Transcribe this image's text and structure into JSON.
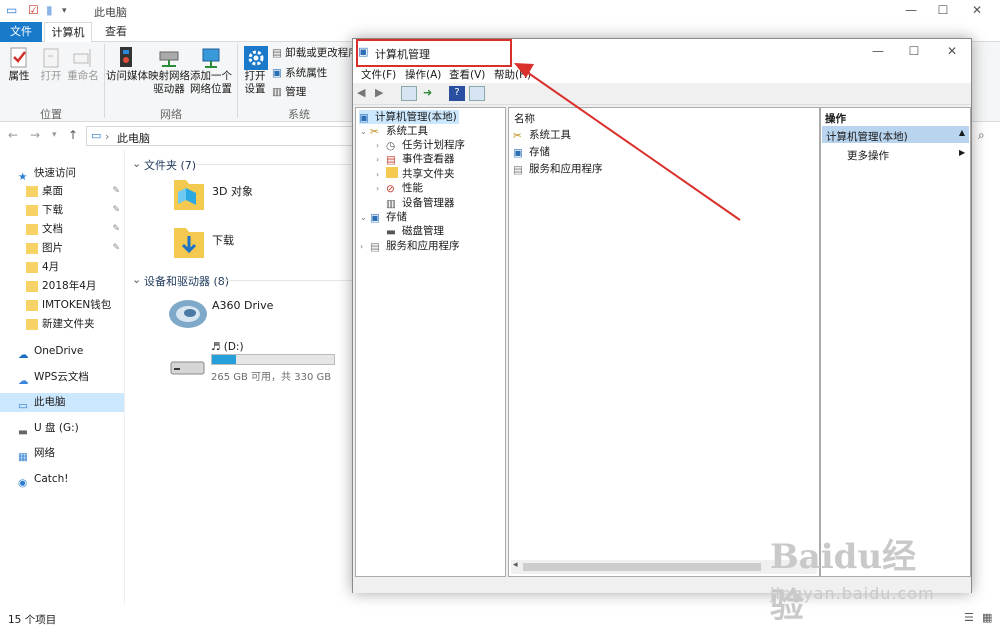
{
  "explorer": {
    "title": "此电脑",
    "tabs": {
      "file": "文件",
      "computer": "计算机",
      "view": "查看"
    },
    "ribbon": {
      "buttons": {
        "properties": "属性",
        "open": "打开",
        "rename": "重命名",
        "access_media": "访问媒体",
        "map_drive": "映射网络\n驱动器",
        "add_location": "添加一个\n网络位置",
        "open_settings": "打开\n设置",
        "uninstall": "卸载或更改程序",
        "system_properties": "系统属性",
        "manage": "管理"
      },
      "groups": {
        "location": "位置",
        "network": "网络",
        "system": "系统"
      }
    },
    "address": {
      "path": "此电脑"
    },
    "nav": {
      "quick_access": "快速访问",
      "items": [
        "桌面",
        "下载",
        "文档",
        "图片",
        "4月",
        "2018年4月",
        "IMTOKEN钱包",
        "新建文件夹"
      ],
      "onedrive": "OneDrive",
      "wps": "WPS云文档",
      "this_pc": "此电脑",
      "usb": "U 盘 (G:)",
      "network": "网络",
      "catch": "Catch!"
    },
    "content": {
      "folders_header": "文件夹 (7)",
      "folders": [
        "3D 对象",
        "下载"
      ],
      "drives_header": "设备和驱动器 (8)",
      "a360": "A360 Drive",
      "d_drive_label": "♬ (D:)",
      "d_drive_space": "265 GB 可用，共 330 GB",
      "d_drive_used_fraction": 0.2
    },
    "status": "15 个项目"
  },
  "cm": {
    "title": "计算机管理",
    "menu": {
      "file": "文件(F)",
      "action": "操作(A)",
      "view": "查看(V)",
      "help": "帮助(H)"
    },
    "tree": {
      "root": "计算机管理(本地)",
      "system_tools": "系统工具",
      "task_scheduler": "任务计划程序",
      "event_viewer": "事件查看器",
      "shared_folders": "共享文件夹",
      "performance": "性能",
      "device_manager": "设备管理器",
      "storage": "存储",
      "disk_management": "磁盘管理",
      "services_apps": "服务和应用程序"
    },
    "center": {
      "header": "名称",
      "items": [
        "系统工具",
        "存储",
        "服务和应用程序"
      ]
    },
    "actions": {
      "header": "操作",
      "selected": "计算机管理(本地)",
      "more": "更多操作"
    }
  },
  "watermark": {
    "logo": "Baidu经验",
    "url": "jingyan.baidu.com"
  }
}
